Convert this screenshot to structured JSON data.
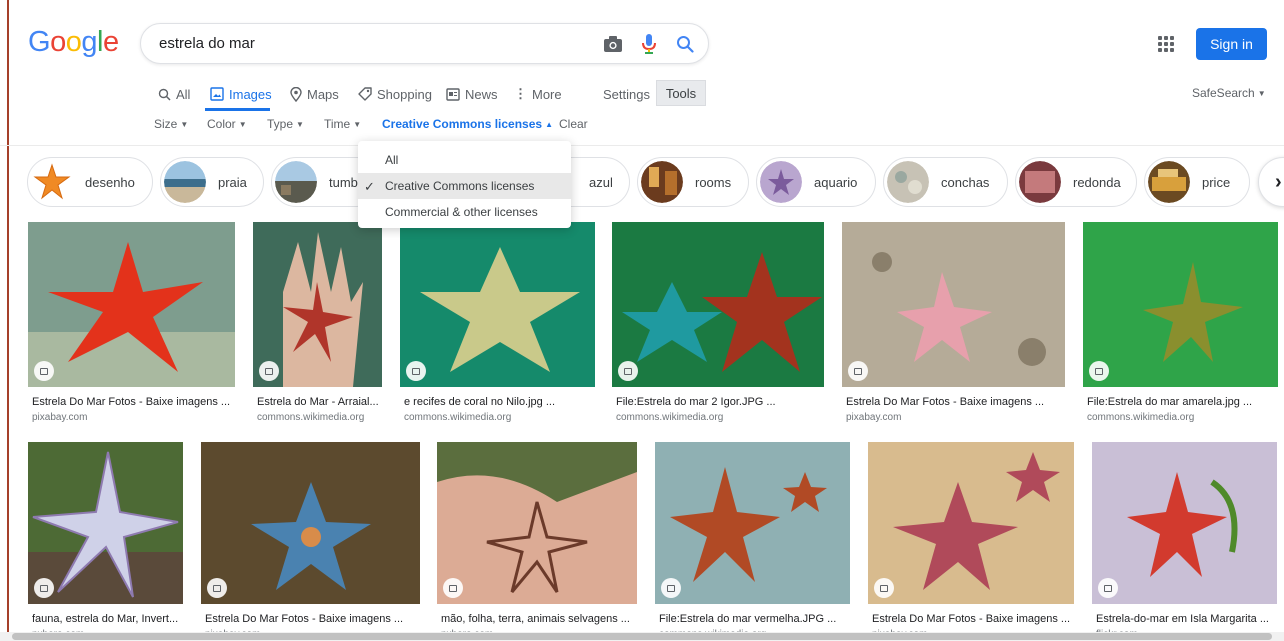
{
  "header": {
    "logo_letters": [
      {
        "ch": "G",
        "color": "#4285f4"
      },
      {
        "ch": "o",
        "color": "#ea4335"
      },
      {
        "ch": "o",
        "color": "#fbbc05"
      },
      {
        "ch": "g",
        "color": "#4285f4"
      },
      {
        "ch": "l",
        "color": "#34a853"
      },
      {
        "ch": "e",
        "color": "#ea4335"
      }
    ],
    "search_query": "estrela do mar",
    "sign_in_label": "Sign in"
  },
  "tabs": [
    {
      "label": "All",
      "icon": "search-icon",
      "active": false
    },
    {
      "label": "Images",
      "icon": "image-icon",
      "active": true
    },
    {
      "label": "Maps",
      "icon": "map-pin-icon",
      "active": false
    },
    {
      "label": "Shopping",
      "icon": "tag-icon",
      "active": false
    },
    {
      "label": "News",
      "icon": "news-icon",
      "active": false
    },
    {
      "label": "More",
      "icon": "more-vert-icon",
      "active": false
    }
  ],
  "settings_label": "Settings",
  "tools_label": "Tools",
  "safesearch_label": "SafeSearch",
  "filters": [
    {
      "label": "Size",
      "active": false
    },
    {
      "label": "Color",
      "active": false
    },
    {
      "label": "Type",
      "active": false
    },
    {
      "label": "Time",
      "active": false
    },
    {
      "label": "Creative Commons licenses",
      "active": true
    },
    {
      "label": "Clear",
      "active": false
    }
  ],
  "license_dropdown": [
    {
      "label": "All",
      "selected": false
    },
    {
      "label": "Creative Commons licenses",
      "selected": true
    },
    {
      "label": "Commercial & other licenses",
      "selected": false
    }
  ],
  "chips": [
    {
      "label": "desenho"
    },
    {
      "label": "praia"
    },
    {
      "label": "tumb"
    },
    {
      "label": "azul"
    },
    {
      "label": "rooms"
    },
    {
      "label": "aquario"
    },
    {
      "label": "conchas"
    },
    {
      "label": "redonda"
    },
    {
      "label": "price"
    }
  ],
  "results": [
    {
      "title": "Estrela Do Mar Fotos - Baixe imagens ...",
      "source": "pixabay.com"
    },
    {
      "title": "Estrela do Mar - Arraial...",
      "source": "commons.wikimedia.org"
    },
    {
      "title": "e recifes de coral no Nilo.jpg ...",
      "source": "commons.wikimedia.org"
    },
    {
      "title": "File:Estrela do mar 2 Igor.JPG ...",
      "source": "commons.wikimedia.org"
    },
    {
      "title": "Estrela Do Mar Fotos - Baixe imagens ...",
      "source": "pixabay.com"
    },
    {
      "title": "File:Estrela do mar amarela.jpg ...",
      "source": "commons.wikimedia.org"
    },
    {
      "title": "fauna, estrela do Mar, Invert...",
      "source": "pxhere.com"
    },
    {
      "title": "Estrela Do Mar Fotos - Baixe imagens ...",
      "source": "pixabay.com"
    },
    {
      "title": "mão, folha, terra, animais selvagens ...",
      "source": "pxhere.com"
    },
    {
      "title": "File:Estrela do mar vermelha.JPG ...",
      "source": "commons.wikimedia.org"
    },
    {
      "title": "Estrela Do Mar Fotos - Baixe imagens ...",
      "source": "pixabay.com"
    },
    {
      "title": "Estrela-do-mar em Isla Margarita ...",
      "source": "flickr.com"
    }
  ]
}
